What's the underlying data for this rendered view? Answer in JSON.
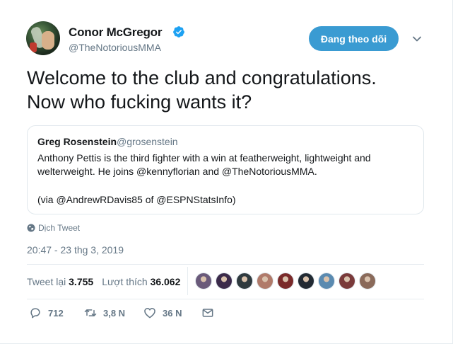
{
  "author": {
    "name": "Conor McGregor",
    "handle": "@TheNotoriousMMA",
    "verified": true
  },
  "follow_button": {
    "label": "Đang theo dõi"
  },
  "tweet": {
    "text_line1": "Welcome to the club and congratulations.",
    "text_line2": "Now who fucking wants it?"
  },
  "quoted": {
    "name": "Greg Rosenstein",
    "handle": "@grosenstein",
    "body": "Anthony Pettis is the third fighter with a win at featherweight, lightweight and welterweight. He joins @kennyflorian and @TheNotoriousMMA.",
    "via": "(via @AndrewRDavis85 of @ESPNStatsInfo)"
  },
  "translate_label": "Dịch Tweet",
  "timestamp": "20:47 - 23 thg 3, 2019",
  "stats": {
    "retweets_label": "Tweet lại",
    "retweets_value": "3.755",
    "likes_label": "Lượt thích",
    "likes_value": "36.062"
  },
  "liker_colors": [
    "#6a5a7a",
    "#3b2a4a",
    "#2f3a3f",
    "#b07a6a",
    "#7a2a2a",
    "#222a33",
    "#5a8ab0",
    "#7a3a3a",
    "#8a6a5a"
  ],
  "actions": {
    "replies": "712",
    "retweets": "3,8 N",
    "likes": "36 N"
  },
  "colors": {
    "accent": "#3a9bd2",
    "secondary_text": "#657786"
  }
}
